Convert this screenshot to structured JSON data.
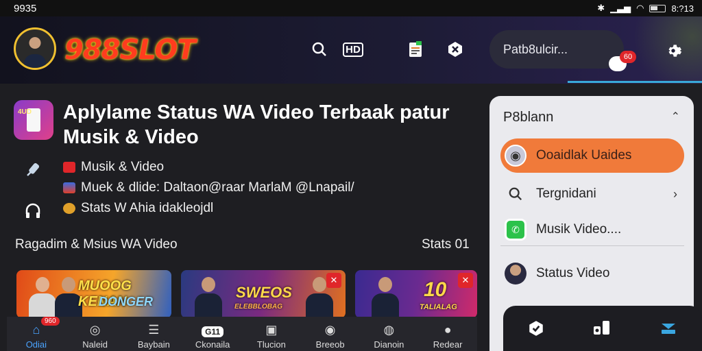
{
  "status_bar": {
    "time": "9935",
    "right_time": "8:?13",
    "icons": [
      "bluetooth-icon",
      "wifi-icon",
      "signal-icon",
      "battery-icon"
    ]
  },
  "header": {
    "logo_text": "988SLOT",
    "search_pill_text": "Patb8ulcir...",
    "notification_count": "60",
    "icons": [
      "search-icon",
      "hd-icon",
      "document-icon",
      "close-icon",
      "chat-icon",
      "gear-icon"
    ],
    "hd_label": "HD"
  },
  "main": {
    "app_icon_tag": "4UD",
    "title": "Aplylame Status WA Video Terbaak patur Musik & Video",
    "info_rows": [
      {
        "icon": "youtube-icon",
        "text": "Musik & Video"
      },
      {
        "icon": "grid-icon",
        "text": "Muek & dlide: Daltaon@raar MarlaM @Lnapail/"
      },
      {
        "icon": "coin-icon",
        "text": "Stats W Ahia idakleojdl"
      }
    ],
    "section_title": "Ragadim & Msius WA Video",
    "stats_label": "Stats 01",
    "thumbnails": [
      {
        "caption_1": "MUOOG KENAN",
        "caption_2": "DONGER",
        "colors": [
          "#d84a1a",
          "#f0a030"
        ]
      },
      {
        "caption_1": "SWEOS",
        "caption_2": "ELEBBLOBAG",
        "colors": [
          "#3a2a70",
          "#e07020"
        ]
      },
      {
        "caption_1": "10",
        "caption_2": "TALIALAG",
        "colors": [
          "#2a2a80",
          "#c02a70"
        ]
      }
    ],
    "thumbnail_close": "✕"
  },
  "bottom_nav": {
    "items": [
      {
        "label": "Odiai",
        "icon": "home-icon",
        "active": true,
        "badge": "960"
      },
      {
        "label": "Naleid",
        "icon": "location-icon",
        "active": false
      },
      {
        "label": "Baybain",
        "icon": "list-icon",
        "active": false
      },
      {
        "label": "Ckonaila",
        "icon": "chat-icon",
        "active": false,
        "chip": "G11"
      },
      {
        "label": "Tlucion",
        "icon": "media-icon",
        "active": false
      },
      {
        "label": "Breeob",
        "icon": "controller-icon",
        "active": false
      },
      {
        "label": "Dianoin",
        "icon": "gamepad-icon",
        "active": false
      },
      {
        "label": "Redear",
        "icon": "profile-icon",
        "active": false
      }
    ]
  },
  "side_panel": {
    "title": "P8blann",
    "items": [
      {
        "label": "Ooaidlak Uaides",
        "icon": "record-icon",
        "active": true
      },
      {
        "label": "Tergnidani",
        "icon": "search-icon",
        "active": false,
        "chevron": "›"
      },
      {
        "label": "Musik Video....",
        "icon": "whatsapp-icon",
        "active": false
      },
      {
        "label": "Status Video",
        "icon": "avatar-icon",
        "active": false
      }
    ],
    "chevron_up": "⌃"
  },
  "dock": {
    "icons": [
      "shield-icon",
      "dj-icon",
      "layers-icon"
    ]
  }
}
